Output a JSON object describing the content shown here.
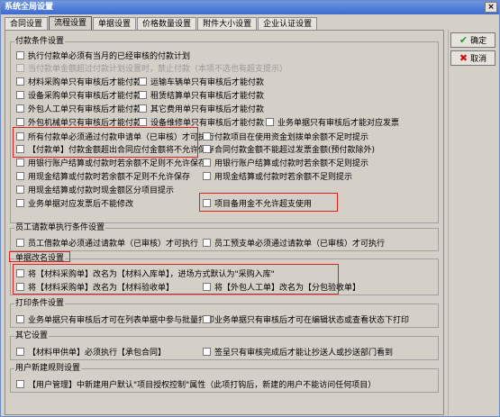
{
  "window": {
    "title": "系统全局设置",
    "close": "×"
  },
  "tabs": [
    "合同设置",
    "流程设置",
    "单据设置",
    "价格数量设置",
    "附件大小设置",
    "企业认证设置"
  ],
  "buttons": {
    "ok": "确定",
    "cancel": "取消"
  },
  "groups": {
    "payment": "付款条件设置",
    "employee": "员工请款单执行条件设置",
    "rename": "单据改名设置",
    "print": "打印条件设置",
    "other": "其它设置",
    "newuser": "用户新建规则设置"
  },
  "payment": {
    "c1": "执行付款单必须有当月的已经审核的付款计划",
    "c2": "当付款单金额超过付款计划设置时，禁止付款（本项不选也有超支提示）",
    "c3": "材料采购单只有审核后才能付款",
    "c4": "运输车辆单只有审核后才能付款",
    "c5": "设备采购单只有审核后才能付款",
    "c6": "租赁结算单只有审核后才能付款",
    "c7": "外包人工单只有审核后才能付款",
    "c8": "其它费用单只有审核后才能付款",
    "c9": "外包机械单只有审核后才能付款",
    "c10": "设备维修单只有审核后才能付款",
    "c11": "业务单据只有审核后才能对应发票",
    "c12": "所有付款单必须通过付款申请单（已审核）才可执行",
    "c13": "付款项目在使用资金划拨单余额不足时提示",
    "c14": "【付款单】付款金额超出合同应付金额将不允许保存",
    "c15": "合同付款金额不能超过发票金额(预付款除外)",
    "c16": "用银行账户结算或付款时若余额不足则不允许保存",
    "c17": "用银行账户结算或付款时若余额不足则提示",
    "c18": "用现金结算或付款时若余额不足则不允许保存",
    "c19": "用现金结算或付款时若余额不足则提示",
    "c20": "用现金结算或付款时现金额区分项目提示",
    "c21": "业务单据对应发票后不能修改",
    "c22": "项目备用金不允许超支使用"
  },
  "employee": {
    "c1": "员工借款单必须通过请款单（已审核）才可执行",
    "c2": "员工预支单必须通过请款单（已审核）才可执行"
  },
  "rename": {
    "c1": "将【材料采购单】改名为【材料入库单】，进场方式默认为\"采购入库\"",
    "c2": "将【材料采购单】改名为【材料验收单】",
    "c3": "将【外包人工单】改名为【分包验收单】"
  },
  "print": {
    "c1": "业务单据只有审核后才可在列表单据中参与批量打印",
    "c2": "业务单据只有审核后才可在编辑状态或查看状态下打印"
  },
  "other": {
    "c1": "【材料甲供单】必须执行【承包合同】",
    "c2": "签呈只有审核完成后才能让抄送人或抄送部门看到"
  },
  "newuser": {
    "c1": "【用户管理】中新建用户默认\"项目授权控制\"属性（此项打钩后，新建的用户不能访问任何项目）"
  }
}
